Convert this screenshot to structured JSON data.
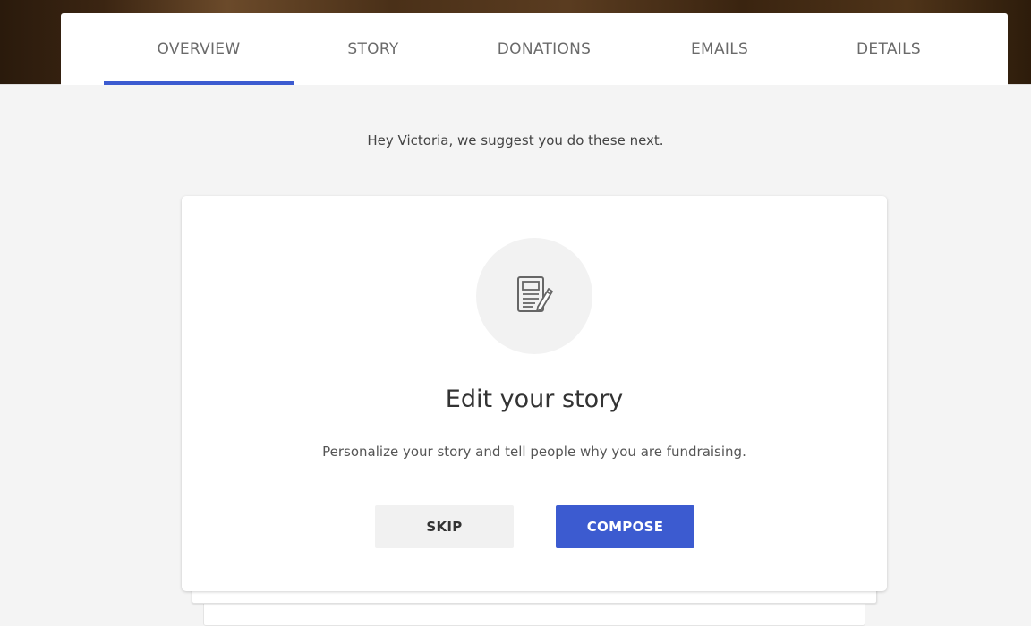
{
  "tabs": [
    {
      "label": "OVERVIEW",
      "active": true
    },
    {
      "label": "STORY",
      "active": false
    },
    {
      "label": "DONATIONS",
      "active": false
    },
    {
      "label": "EMAILS",
      "active": false
    },
    {
      "label": "DETAILS",
      "active": false
    }
  ],
  "suggestion_text": "Hey Victoria, we suggest you do these next.",
  "card": {
    "icon": "document-edit-icon",
    "title": "Edit your story",
    "description": "Personalize your story and tell people why you are fundraising.",
    "skip_label": "SKIP",
    "compose_label": "COMPOSE"
  },
  "colors": {
    "accent": "#3c5bd0",
    "page_background": "#f4f4f4"
  }
}
